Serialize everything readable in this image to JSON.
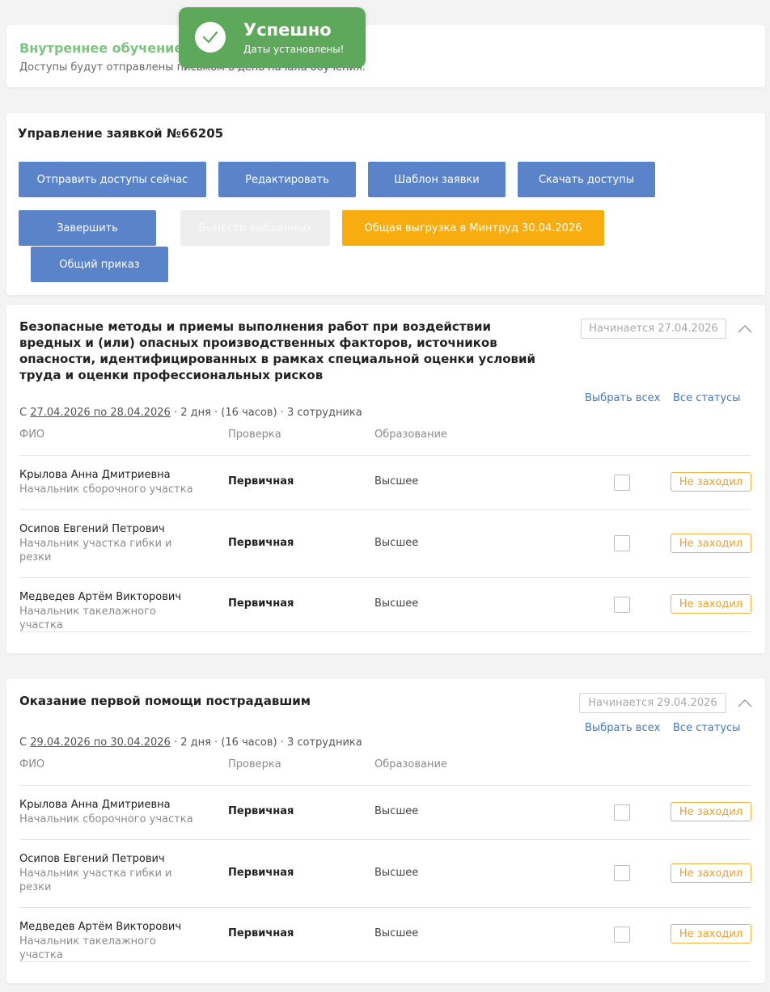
{
  "toast": {
    "title": "Успешно",
    "text": "Даты установлены!",
    "icon": "check-icon",
    "color": "#5ea85c"
  },
  "info": {
    "title": "Внутреннее обучение.",
    "text": "Доступы будут отправлены письмом в день начала обучения."
  },
  "management": {
    "title": "Управление заявкой №66205",
    "buttons": {
      "send_now": "Отправить доступы сейчас",
      "edit": "Редактировать",
      "template": "Шаблон заявки",
      "download": "Скачать доступы",
      "finish": "Завершить",
      "remove_selected": "Вынести выбранных",
      "export": "Общая выгрузка в Минтруд 30.04.2026",
      "order": "Общий приказ"
    },
    "colors": {
      "primary": "#5b83c9",
      "accent": "#f8ac10"
    }
  },
  "columns": {
    "fio": "ФИО",
    "check": "Проверка",
    "education": "Образование"
  },
  "courses": [
    {
      "title_lines": [
        "Безопасные методы и приемы выполнения работ при воздействии",
        "вредных и (или) опасных производственных факторов, источников",
        "опасности, идентифицированных в рамках специальной оценки условий",
        "труда и оценки профессиональных рисков"
      ],
      "start_badge": "Начинается 27.04.2026",
      "select_all": "Выбрать всех",
      "all_statuses": "Все статусы",
      "meta_prefix": "С ",
      "meta_dates": "27.04.2026 по 28.04.2026",
      "meta_suffix": " · 2 дня · (16 часов) · 3 сотрудника",
      "employees": [
        {
          "name": "Крылова Анна Дмитриевна",
          "position_lines": [
            "Начальник сборочного участка"
          ],
          "check": "Первичная",
          "education": "Высшее",
          "status": "Не заходил"
        },
        {
          "name": "Осипов Евгений Петрович",
          "position_lines": [
            "Начальник участка гибки и",
            "резки"
          ],
          "check": "Первичная",
          "education": "Высшее",
          "status": "Не заходил"
        },
        {
          "name": "Медведев Артём Викторович",
          "position_lines": [
            "Начальник такелажного участка"
          ],
          "check": "Первичная",
          "education": "Высшее",
          "status": "Не заходил"
        }
      ]
    },
    {
      "title_lines": [
        "Оказание первой помощи пострадавшим"
      ],
      "start_badge": "Начинается 29.04.2026",
      "select_all": "Выбрать всех",
      "all_statuses": "Все статусы",
      "meta_prefix": "С ",
      "meta_dates": "29.04.2026 по 30.04.2026",
      "meta_suffix": " · 2 дня · (16 часов) · 3 сотрудника",
      "employees": [
        {
          "name": "Крылова Анна Дмитриевна",
          "position_lines": [
            "Начальник сборочного участка"
          ],
          "check": "Первичная",
          "education": "Высшее",
          "status": "Не заходил"
        },
        {
          "name": "Осипов Евгений Петрович",
          "position_lines": [
            "Начальник участка гибки и",
            "резки"
          ],
          "check": "Первичная",
          "education": "Высшее",
          "status": "Не заходил"
        },
        {
          "name": "Медведев Артём Викторович",
          "position_lines": [
            "Начальник такелажного участка"
          ],
          "check": "Первичная",
          "education": "Высшее",
          "status": "Не заходил"
        }
      ]
    }
  ]
}
